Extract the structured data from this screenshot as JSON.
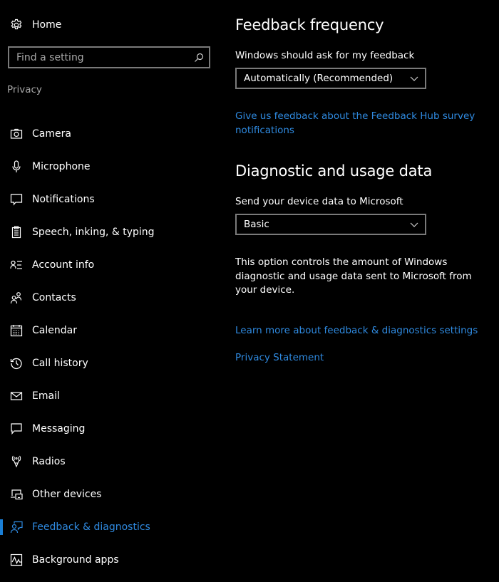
{
  "sidebar": {
    "home": {
      "label": "Home",
      "icon": "gear-icon"
    },
    "search": {
      "placeholder": "Find a setting",
      "value": "",
      "icon": "search-icon"
    },
    "section_label": "Privacy",
    "items": [
      {
        "label": "Camera",
        "icon": "camera-icon",
        "active": false
      },
      {
        "label": "Microphone",
        "icon": "microphone-icon",
        "active": false
      },
      {
        "label": "Notifications",
        "icon": "notifications-icon",
        "active": false
      },
      {
        "label": "Speech, inking, & typing",
        "icon": "clipboard-icon",
        "active": false
      },
      {
        "label": "Account info",
        "icon": "account-info-icon",
        "active": false
      },
      {
        "label": "Contacts",
        "icon": "contacts-icon",
        "active": false
      },
      {
        "label": "Calendar",
        "icon": "calendar-icon",
        "active": false
      },
      {
        "label": "Call history",
        "icon": "history-icon",
        "active": false
      },
      {
        "label": "Email",
        "icon": "email-icon",
        "active": false
      },
      {
        "label": "Messaging",
        "icon": "messaging-icon",
        "active": false
      },
      {
        "label": "Radios",
        "icon": "radios-icon",
        "active": false
      },
      {
        "label": "Other devices",
        "icon": "devices-icon",
        "active": false
      },
      {
        "label": "Feedback & diagnostics",
        "icon": "feedback-icon",
        "active": true
      },
      {
        "label": "Background apps",
        "icon": "background-apps-icon",
        "active": false
      }
    ]
  },
  "main": {
    "feedback_frequency": {
      "title": "Feedback frequency",
      "field_label": "Windows should ask for my feedback",
      "selected": "Automatically (Recommended)",
      "link": "Give us feedback about the Feedback Hub survey notifications"
    },
    "diagnostic": {
      "title": "Diagnostic and usage data",
      "field_label": "Send your device data to Microsoft",
      "selected": "Basic",
      "description": "This option controls the amount of Windows diagnostic and usage data sent to Microsoft from your device."
    },
    "links": {
      "learn_more": "Learn more about feedback & diagnostics settings",
      "privacy_statement": "Privacy Statement"
    }
  },
  "colors": {
    "background": "#000000",
    "accent": "#2f8ae0",
    "indicator": "#1a7fd6",
    "border": "#7a7a7a",
    "secondary_text": "#a6a6a6"
  }
}
